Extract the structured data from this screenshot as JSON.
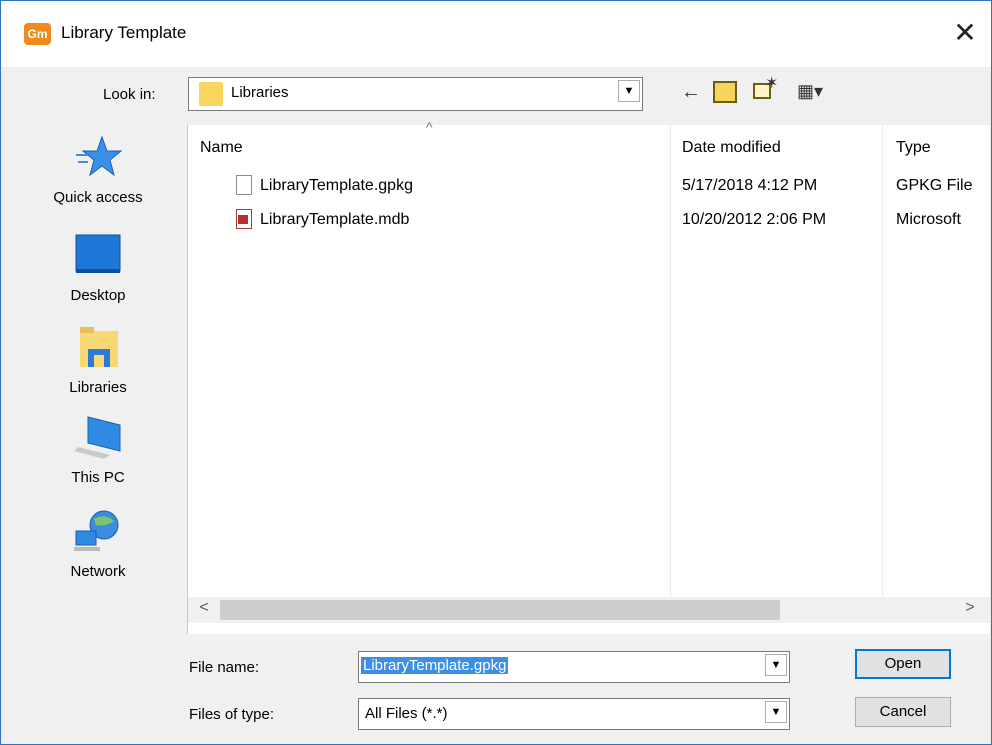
{
  "window": {
    "title": "Library Template",
    "app_icon_text": "Gm",
    "close_glyph": "✕"
  },
  "lookin": {
    "label": "Look in:",
    "value": "Libraries"
  },
  "toolbar": {
    "back_glyph": "←",
    "up_glyph": "🗀",
    "new_folder_glyph": "✶",
    "view_glyph": "▦▾"
  },
  "places": [
    {
      "label": "Quick access",
      "icon": "star-icon"
    },
    {
      "label": "Desktop",
      "icon": "desktop-icon"
    },
    {
      "label": "Libraries",
      "icon": "libraries-icon"
    },
    {
      "label": "This PC",
      "icon": "computer-icon"
    },
    {
      "label": "Network",
      "icon": "network-icon"
    }
  ],
  "list": {
    "columns": [
      "Name",
      "Date modified",
      "Type"
    ],
    "sort_glyph": "^",
    "rows": [
      {
        "name": "LibraryTemplate.gpkg",
        "date": "5/17/2018 4:12 PM",
        "type": "GPKG File",
        "icon": "file-icon"
      },
      {
        "name": "LibraryTemplate.mdb",
        "date": "10/20/2012 2:06 PM",
        "type": "Microsoft",
        "icon": "access-db-icon"
      }
    ],
    "scroll_left": "<",
    "scroll_right": ">"
  },
  "filename": {
    "label": "File name:",
    "value": "LibraryTemplate.gpkg"
  },
  "filetype": {
    "label": "Files of type:",
    "value": "All Files (*.*)"
  },
  "buttons": {
    "open": "Open",
    "cancel": "Cancel"
  },
  "colors": {
    "accent": "#0078d7",
    "selection": "#3c90e3",
    "app_icon": "#f08a1c"
  }
}
